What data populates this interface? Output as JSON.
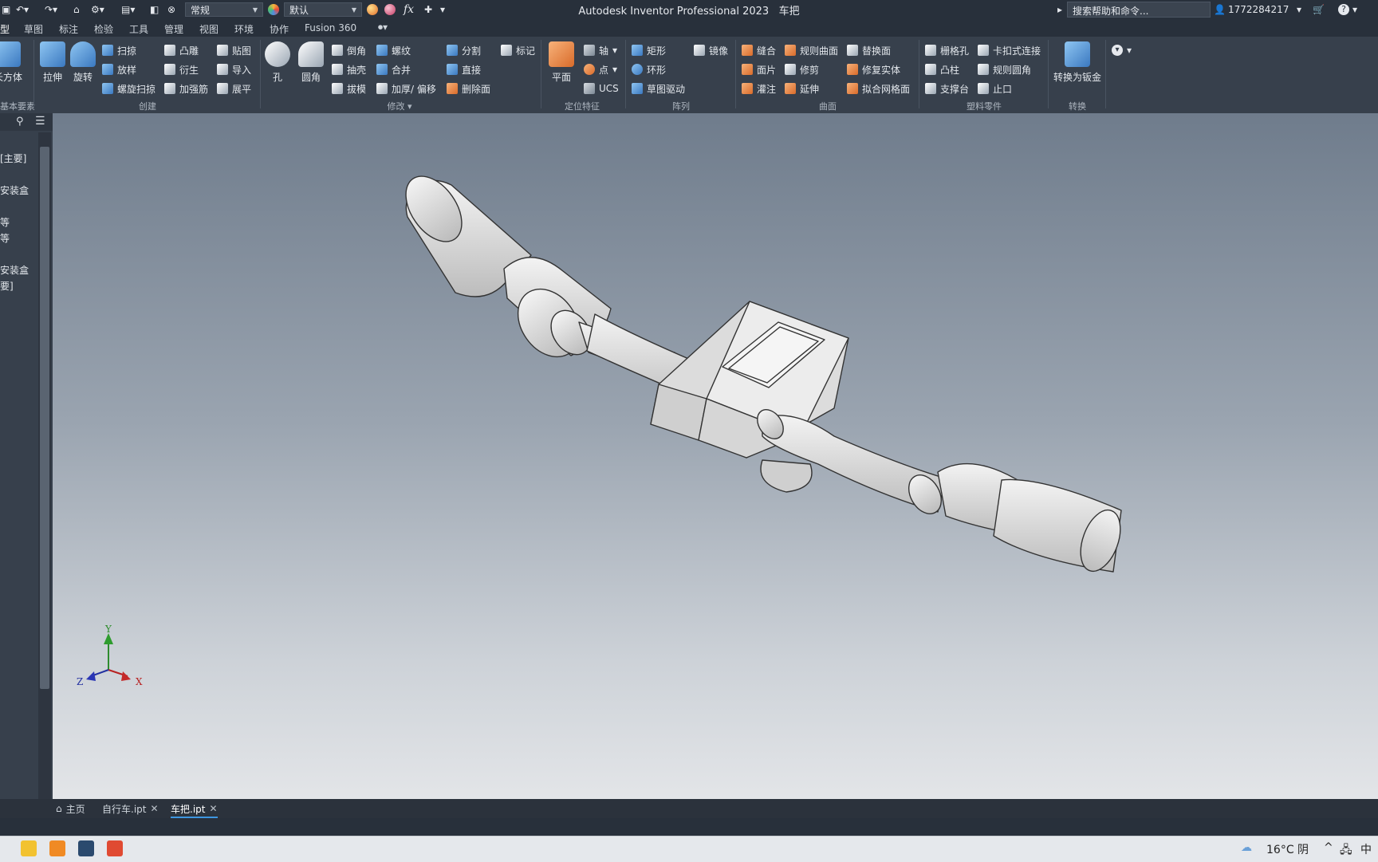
{
  "titlebar": {
    "app_title": "Autodesk Inventor Professional 2023",
    "doc_title": "车把",
    "appearance_combo": "常规",
    "material_combo": "默认",
    "fx_label": "fx",
    "search_placeholder": "搜索帮助和命令...",
    "user_id": "1772284217"
  },
  "ribbon_tabs": [
    "型",
    "草图",
    "标注",
    "检验",
    "工具",
    "管理",
    "视图",
    "环境",
    "协作",
    "Fusion 360"
  ],
  "ribbon": {
    "create": {
      "label": "创建",
      "box": "长方体",
      "extrude": "拉伸",
      "revolve": "旋转",
      "sweep": "扫掠",
      "loft": "放样",
      "coil": "螺旋扫掠",
      "emboss": "凸雕",
      "derive": "衍生",
      "rib": "加强筋",
      "decal": "贴图",
      "import": "导入",
      "unwrap": "展平"
    },
    "basic_label": "基本要素",
    "modify": {
      "label": "修改",
      "hole": "孔",
      "fillet": "圆角",
      "chamfer": "倒角",
      "shell": "抽壳",
      "draft": "拔模",
      "thread": "螺纹",
      "combine": "合并",
      "thicken": "加厚/ 偏移",
      "split": "分割",
      "direct": "直接",
      "delete_face": "删除面",
      "mark": "标记"
    },
    "work": {
      "label": "定位特征",
      "plane": "平面",
      "axis": "轴",
      "point": "点",
      "ucs": "UCS"
    },
    "pattern": {
      "label": "阵列",
      "rect": "矩形",
      "circ": "环形",
      "sketch_driven": "草图驱动",
      "mirror": "镜像"
    },
    "surface": {
      "label": "曲面",
      "stitch": "缝合",
      "patch": "面片",
      "sculpt": "灌注",
      "ruled": "规则曲面",
      "trim": "修剪",
      "extend": "延伸",
      "replace": "替换面",
      "repair": "修复实体",
      "fit_mesh": "拟合网格面"
    },
    "plastic": {
      "label": "塑料零件",
      "grill": "栅格孔",
      "boss": "凸柱",
      "rest": "支撑台",
      "snap": "卡扣式连接",
      "rule_fillet": "规则圆角",
      "lip": "止口"
    },
    "convert": {
      "label": "转换",
      "sheet_metal": "转换为钣金"
    }
  },
  "browser": {
    "items": [
      "[主要]",
      "安装盒",
      "等",
      "等",
      "安装盒",
      "要]"
    ]
  },
  "axis_labels": {
    "x": "X",
    "y": "Y",
    "z": "Z"
  },
  "doc_tabs": {
    "home": "主页",
    "tab1": "自行车.ipt",
    "tab2": "车把.ipt"
  },
  "tray": {
    "weather": "16°C 阴",
    "ime": "中"
  },
  "colors": {
    "accent": "#3d96e0",
    "ribbon_bg": "#37404c",
    "viewport_top": "#6f7c8c",
    "viewport_bottom": "#e3e5e8"
  }
}
